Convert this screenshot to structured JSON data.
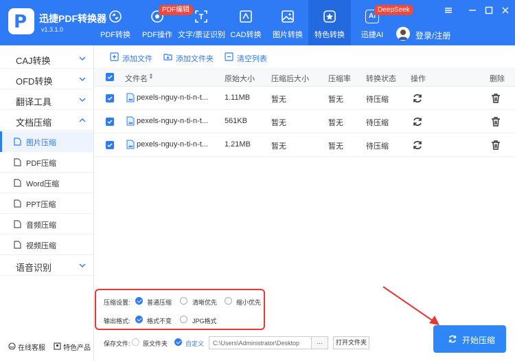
{
  "app": {
    "name": "迅捷PDF转换器",
    "version": "v1.3.1.0",
    "logo_letter": "P"
  },
  "nav": [
    {
      "label": "PDF转换",
      "icon": "pdf-convert-icon"
    },
    {
      "label": "PDF操作",
      "icon": "pdf-operate-icon",
      "badge": "PDF编辑"
    },
    {
      "label": "文字/票证识别",
      "icon": "ocr-icon"
    },
    {
      "label": "CAD转换",
      "icon": "cad-icon"
    },
    {
      "label": "图片转换",
      "icon": "image-icon"
    },
    {
      "label": "特色转换",
      "icon": "star-icon",
      "active": true
    },
    {
      "label": "迅捷AI",
      "icon": "ai-icon",
      "badge": "DeepSeek",
      "icon_text": "AI"
    }
  ],
  "user": {
    "login_label": "登录/注册"
  },
  "sidebar": {
    "categories": [
      {
        "label": "CAJ转换"
      },
      {
        "label": "OFD转换"
      },
      {
        "label": "翻译工具"
      },
      {
        "label": "文档压缩",
        "expanded": true
      },
      {
        "label": "语音识别"
      }
    ],
    "sub_items": [
      {
        "label": "图片压缩",
        "active": true
      },
      {
        "label": "PDF压缩"
      },
      {
        "label": "Word压缩"
      },
      {
        "label": "PPT压缩"
      },
      {
        "label": "音频压缩"
      },
      {
        "label": "视频压缩"
      }
    ],
    "bottom": {
      "service": "在线客服",
      "products": "特色产品"
    }
  },
  "toolbar": {
    "add_file": "添加文件",
    "add_folder": "添加文件夹",
    "clear_list": "清空列表"
  },
  "table": {
    "headers": {
      "filename": "文件名",
      "sort": "⇕",
      "orig_size": "原始大小",
      "comp_size": "压缩后大小",
      "ratio": "压缩率",
      "status": "转换状态",
      "action": "操作",
      "delete": "删除"
    },
    "rows": [
      {
        "filename": "pexels-nguy-n-ti-n-t...",
        "orig_size": "1.11MB",
        "comp_size": "暂无",
        "ratio": "暂无",
        "status": "待压缩"
      },
      {
        "filename": "pexels-nguy-n-ti-n-t...",
        "orig_size": "561KB",
        "comp_size": "暂无",
        "ratio": "暂无",
        "status": "待压缩"
      },
      {
        "filename": "pexels-nguy-n-ti-n-t...",
        "orig_size": "1.21MB",
        "comp_size": "暂无",
        "ratio": "暂无",
        "status": "待压缩"
      }
    ]
  },
  "settings": {
    "compress_label": "压缩设置:",
    "compress_options": [
      {
        "label": "普通压缩",
        "selected": true
      },
      {
        "label": "清晰优先",
        "selected": false
      },
      {
        "label": "缩小优先",
        "selected": false
      }
    ],
    "format_label": "输出格式:",
    "format_options": [
      {
        "label": "格式不变",
        "selected": true
      },
      {
        "label": "JPG格式",
        "selected": false
      }
    ]
  },
  "save": {
    "label": "保存文件:",
    "options": [
      {
        "label": "原文件夹",
        "selected": false
      },
      {
        "label": "自定义",
        "selected": true
      }
    ],
    "path": "C:\\Users\\Administrator\\Desktop",
    "browse": "...",
    "open_folder": "打开文件夹"
  },
  "start_button": "开始压缩",
  "colors": {
    "brand": "#2f7bf6",
    "highlight": "#e53935",
    "badge": "#f0483c"
  }
}
